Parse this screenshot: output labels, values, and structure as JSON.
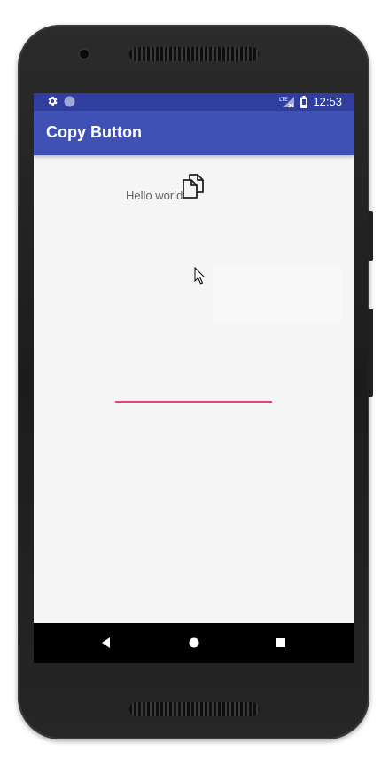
{
  "device": {
    "frame_color": "#262626"
  },
  "status_bar": {
    "color": "#303f9f",
    "time": "12:53",
    "icons": [
      "gear-icon",
      "circle-icon",
      "lte-signal-icon",
      "battery-icon"
    ]
  },
  "app_bar": {
    "color": "#3f51b5",
    "title": "Copy Button"
  },
  "content": {
    "text": "Hello world",
    "copy_icon": "copy-icon",
    "input_underline_color": "#ec407a",
    "input_value": ""
  },
  "nav_bar": {
    "buttons": [
      "back-icon",
      "home-icon",
      "recents-icon"
    ]
  }
}
